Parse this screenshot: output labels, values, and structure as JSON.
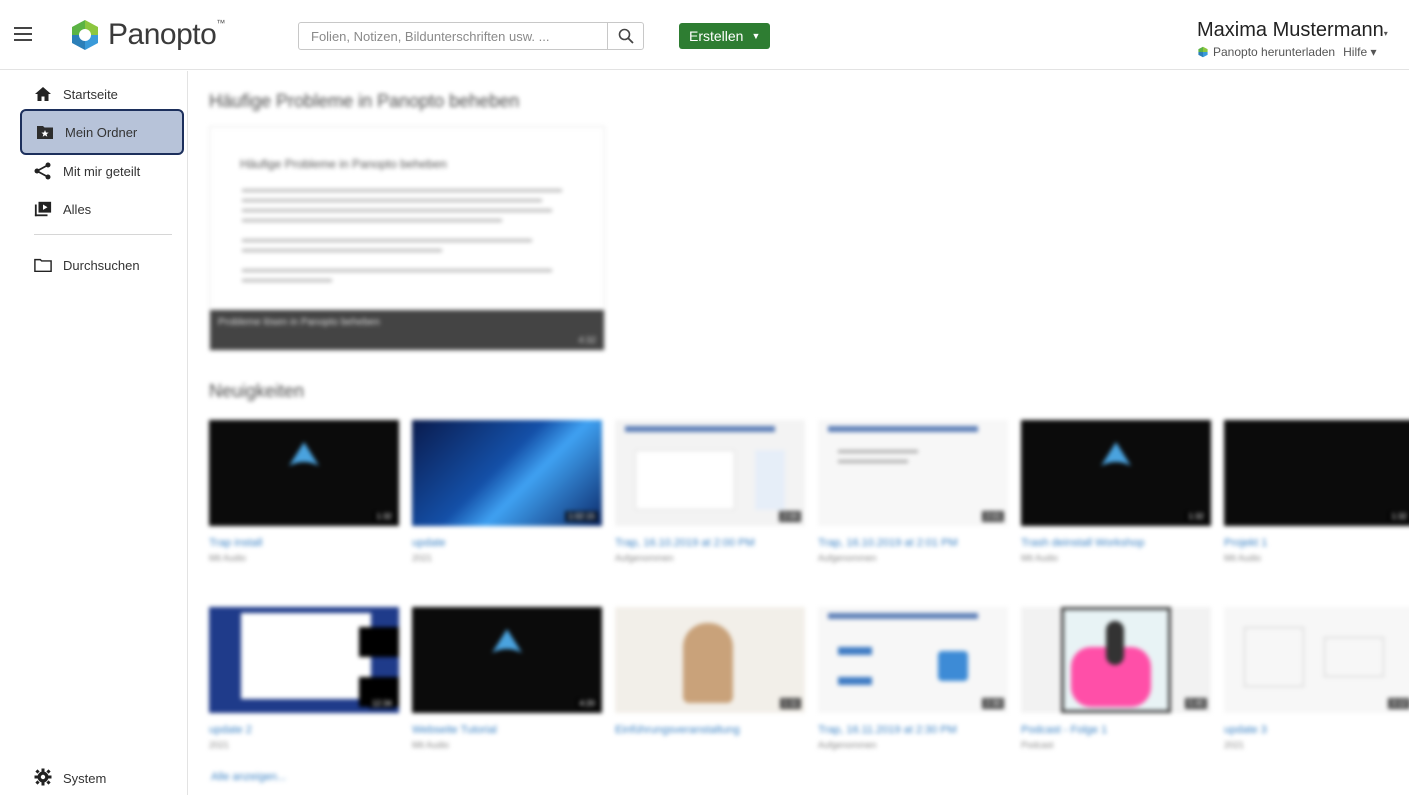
{
  "header": {
    "brand": "Panopto",
    "brand_tm": "™",
    "search_placeholder": "Folien, Notizen, Bildunterschriften usw. ...",
    "create_label": "Erstellen",
    "user_name": "Maxima Mustermann",
    "download_label": "Panopto herunterladen",
    "help_label": "Hilfe"
  },
  "sidebar": {
    "items": [
      {
        "label": "Startseite",
        "icon": "home-icon"
      },
      {
        "label": "Mein Ordner",
        "icon": "star-folder-icon",
        "selected": true
      },
      {
        "label": "Mit mir geteilt",
        "icon": "share-icon"
      },
      {
        "label": "Alles",
        "icon": "play-list-icon"
      },
      {
        "label": "Durchsuchen",
        "icon": "folder-icon"
      }
    ],
    "system_label": "System"
  },
  "main": {
    "featured_title": "Häufige Probleme in Panopto beheben",
    "featured_slide_title": "Häufige Probleme in Panopto beheben",
    "featured_caption": "Probleme lösen in Panopto beheben",
    "recent_title": "Neuigkeiten",
    "show_all": "Alle anzeigen...",
    "cards": [
      {
        "title": "Trap install",
        "sub": "Mit Audio",
        "dur": "1:32"
      },
      {
        "title": "update",
        "sub": "2021",
        "dur": "1:02:15"
      },
      {
        "title": "Trap, 16.10.2019 at 2:00 PM",
        "sub": "Aufgenommen",
        "dur": "2:00"
      },
      {
        "title": "Trap, 16.10.2019 at 2:01 PM",
        "sub": "Aufgenommen",
        "dur": "2:01"
      },
      {
        "title": "Trash deinstall Workshop",
        "sub": "Mit Audio",
        "dur": "1:32"
      },
      {
        "title": "Projekt 1",
        "sub": "Mit Audio",
        "dur": "1:32"
      },
      {
        "title": "update 2",
        "sub": "2021",
        "dur": "12:34"
      },
      {
        "title": "Webseite Tutorial",
        "sub": "Mit Audio",
        "dur": "4:20"
      },
      {
        "title": "Einführungsveranstaltung",
        "sub": "",
        "dur": "1:11"
      },
      {
        "title": "Trap, 16.11.2019 at 2:30 PM",
        "sub": "Aufgenommen",
        "dur": "2:30"
      },
      {
        "title": "Podcast - Folge 1",
        "sub": "Podcast",
        "dur": "5:45"
      },
      {
        "title": "update 3",
        "sub": "2021",
        "dur": "3:12"
      }
    ]
  },
  "colors": {
    "accent_green": "#2e7d32",
    "selected_bg": "#b7c3d9",
    "selected_border": "#1c2f5c",
    "link_blue": "#3b82c4"
  }
}
